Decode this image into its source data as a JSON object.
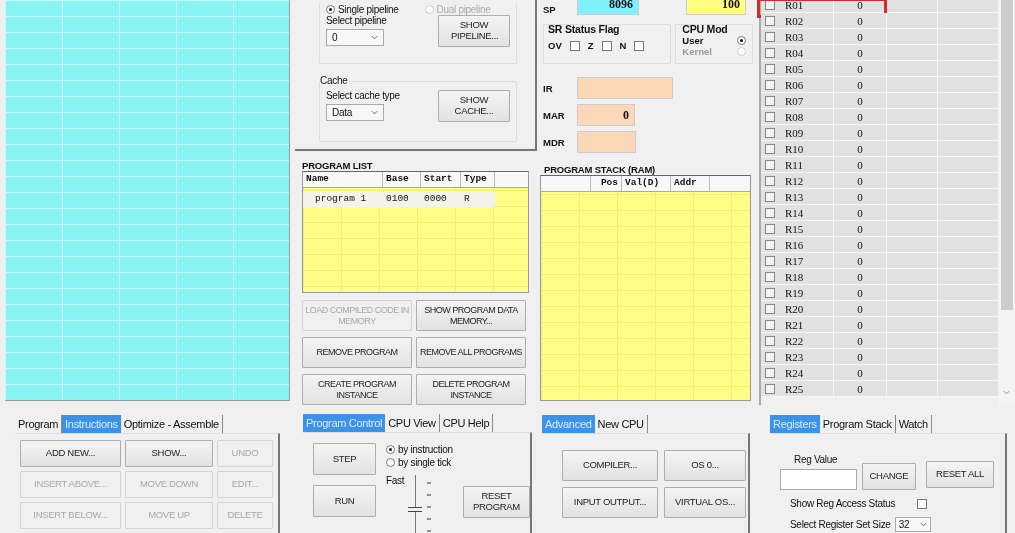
{
  "pipeline": {
    "modes": [
      {
        "label": "Single pipeline",
        "selected": true,
        "disabled": false
      },
      {
        "label": "Dual pipeline",
        "selected": false,
        "disabled": true
      }
    ],
    "select_label": "Select pipeline",
    "select_value": "0",
    "button": "SHOW PIPELINE..."
  },
  "cache": {
    "title": "Cache",
    "select_label": "Select cache type",
    "select_value": "Data",
    "button": "SHOW CACHE..."
  },
  "cpu": {
    "sp_label": "SP",
    "sp_value": "8096",
    "sr_value": "100",
    "status_title": "SR Status Flag",
    "flags": [
      {
        "label": "OV",
        "checked": false
      },
      {
        "label": "Z",
        "checked": false
      },
      {
        "label": "N",
        "checked": false
      }
    ],
    "mode_title": "CPU Mod",
    "modes": [
      {
        "label": "User",
        "selected": true,
        "disabled": false
      },
      {
        "label": "Kernel",
        "selected": false,
        "disabled": true
      }
    ],
    "fields": [
      {
        "label": "IR"
      },
      {
        "label": "MAR",
        "value": "0"
      },
      {
        "label": "MDR"
      }
    ]
  },
  "program_list": {
    "title": "PROGRAM LIST",
    "columns": [
      "Name",
      "Base",
      "Start",
      "Type"
    ],
    "rows": [
      [
        "program 1",
        "0100",
        "0000",
        "R"
      ]
    ],
    "buttons": [
      {
        "label": "LOAD COMPILED CODE IN MEMORY",
        "disabled": true
      },
      {
        "label": "SHOW PROGRAM  DATA MEMORY...",
        "disabled": false
      },
      {
        "label": "REMOVE PROGRAM",
        "disabled": false
      },
      {
        "label": "REMOVE ALL PROGRAMS",
        "disabled": false
      },
      {
        "label": "CREATE PROGRAM INSTANCE",
        "disabled": false
      },
      {
        "label": "DELETE PROGRAM INSTANCE",
        "disabled": false
      }
    ]
  },
  "program_stack": {
    "title": "PROGRAM STACK (RAM)",
    "columns": [
      "Pos",
      "Val(D)",
      "Addr"
    ]
  },
  "registers": [
    {
      "name": "R01",
      "value": "0",
      "checked": false,
      "highlighted": true
    },
    {
      "name": "R02",
      "value": "0",
      "checked": false,
      "highlighted": false
    },
    {
      "name": "R03",
      "value": "0",
      "checked": false,
      "highlighted": false
    },
    {
      "name": "R04",
      "value": "0",
      "checked": false,
      "highlighted": false
    },
    {
      "name": "R05",
      "value": "0",
      "checked": false,
      "highlighted": false
    },
    {
      "name": "R06",
      "value": "0",
      "checked": false,
      "highlighted": false
    },
    {
      "name": "R07",
      "value": "0",
      "checked": false,
      "highlighted": false
    },
    {
      "name": "R08",
      "value": "0",
      "checked": false,
      "highlighted": false
    },
    {
      "name": "R09",
      "value": "0",
      "checked": false,
      "highlighted": false
    },
    {
      "name": "R10",
      "value": "0",
      "checked": false,
      "highlighted": false
    },
    {
      "name": "R11",
      "value": "0",
      "checked": false,
      "highlighted": false
    },
    {
      "name": "R12",
      "value": "0",
      "checked": false,
      "highlighted": false
    },
    {
      "name": "R13",
      "value": "0",
      "checked": false,
      "highlighted": false
    },
    {
      "name": "R14",
      "value": "0",
      "checked": false,
      "highlighted": false
    },
    {
      "name": "R15",
      "value": "0",
      "checked": false,
      "highlighted": false
    },
    {
      "name": "R16",
      "value": "0",
      "checked": false,
      "highlighted": false
    },
    {
      "name": "R17",
      "value": "0",
      "checked": false,
      "highlighted": false
    },
    {
      "name": "R18",
      "value": "0",
      "checked": false,
      "highlighted": false
    },
    {
      "name": "R19",
      "value": "0",
      "checked": false,
      "highlighted": false
    },
    {
      "name": "R20",
      "value": "0",
      "checked": false,
      "highlighted": false
    },
    {
      "name": "R21",
      "value": "0",
      "checked": false,
      "highlighted": false
    },
    {
      "name": "R22",
      "value": "0",
      "checked": false,
      "highlighted": false
    },
    {
      "name": "R23",
      "value": "0",
      "checked": false,
      "highlighted": false
    },
    {
      "name": "R24",
      "value": "0",
      "checked": false,
      "highlighted": false
    },
    {
      "name": "R25",
      "value": "0",
      "checked": false,
      "highlighted": false
    }
  ],
  "instructions_panel": {
    "tabs": [
      {
        "label": "Program",
        "selected": false
      },
      {
        "label": "Instructions",
        "selected": true
      },
      {
        "label": "Optimize - Assemble",
        "selected": false
      }
    ],
    "buttons": [
      {
        "label": "ADD NEW...",
        "disabled": false
      },
      {
        "label": "SHOW...",
        "disabled": false
      },
      {
        "label": "UNDO",
        "disabled": true
      },
      {
        "label": "INSERT ABOVE...",
        "disabled": true
      },
      {
        "label": "MOVE DOWN",
        "disabled": true
      },
      {
        "label": "EDIT...",
        "disabled": true
      },
      {
        "label": "INSERT BELOW...",
        "disabled": true
      },
      {
        "label": "MOVE UP",
        "disabled": true
      },
      {
        "label": "DELETE",
        "disabled": true
      }
    ]
  },
  "control_panel": {
    "tabs": [
      {
        "label": "Program Control",
        "selected": true
      },
      {
        "label": "CPU View",
        "selected": false
      },
      {
        "label": "CPU Help",
        "selected": false
      }
    ],
    "step": "STEP",
    "run": "RUN",
    "modes": [
      {
        "label": "by instruction",
        "selected": true
      },
      {
        "label": "by single tick",
        "selected": false
      }
    ],
    "speed_label": "Fast",
    "speed": {
      "level": 0.6
    },
    "reset": "RESET PROGRAM"
  },
  "advanced_panel": {
    "tabs": [
      {
        "label": "Advanced",
        "selected": true
      },
      {
        "label": "New CPU",
        "selected": false
      }
    ],
    "buttons": [
      "COMPILER...",
      "OS 0...",
      "INPUT OUTPUT...",
      "VIRTUAL OS..."
    ]
  },
  "register_panel": {
    "tabs": [
      {
        "label": "Registers",
        "selected": true
      },
      {
        "label": "Program Stack",
        "selected": false
      },
      {
        "label": "Watch",
        "selected": false
      }
    ],
    "reg_value_label": "Reg Value",
    "change": "CHANGE",
    "reset_all": "RESET ALL",
    "access_label": "Show Reg Access Status",
    "access_checked": false,
    "size_label": "Select Register Set Size",
    "size_value": "32"
  }
}
